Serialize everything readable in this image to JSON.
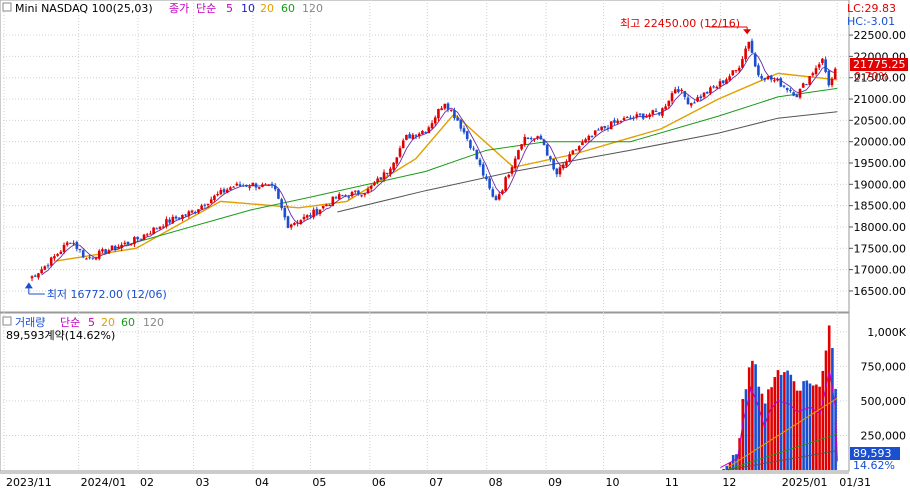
{
  "price_header": {
    "symbol": "Mini NASDAQ 100(25,03)",
    "close_label": "종가",
    "ma_label": "단순",
    "ma_periods": [
      "5",
      "10",
      "20",
      "60",
      "120"
    ],
    "ma_colors": [
      "#c000c0",
      "#1a1acc",
      "#e0a000",
      "#1a9a1a",
      "#888888"
    ]
  },
  "price_right": {
    "lc": "LC:29.83",
    "hc": "HC:-3.01",
    "last_price": "21775.25",
    "last_pct": "0.70%"
  },
  "volume_header": {
    "label": "거래량",
    "ma_label": "단순",
    "ma_periods": [
      "5",
      "20",
      "60",
      "120"
    ],
    "value_line": "89,593계약(14.62%)"
  },
  "volume_right": {
    "last_volume": "89,593",
    "last_pct": "14.62%"
  },
  "colors": {
    "up": "#e00000",
    "down": "#1a4fd0",
    "grid": "#d0d0d0",
    "badge_red": "#e00000",
    "badge_blue": "#1a4fd0"
  },
  "chart_data": [
    {
      "type": "candlestick",
      "title": "Mini NASDAQ 100(25,03)",
      "x_labels": [
        "2023/11",
        "2024/01",
        "02",
        "03",
        "04",
        "05",
        "06",
        "07",
        "08",
        "09",
        "10",
        "11",
        "12",
        "2025/01",
        "01/31"
      ],
      "y_ticks": [
        16500,
        17000,
        17500,
        18000,
        18500,
        19000,
        19500,
        20000,
        20500,
        21000,
        21500,
        22000,
        22500
      ],
      "y_tick_labels": [
        "16500.00",
        "17000.00",
        "17500.00",
        "18000.00",
        "18500.00",
        "19000.00",
        "19500.00",
        "20000.00",
        "20500.00",
        "21000.00",
        "21500.00",
        "22000.00",
        "22500.00"
      ],
      "ylim": [
        16100,
        22900
      ],
      "annotations": [
        {
          "text": "최고 22450.00 (12/16)",
          "value": 22450,
          "date": "12/16"
        },
        {
          "text": "최저 16772.00 (12/06)",
          "value": 16772,
          "date": "12/06"
        }
      ],
      "close_path": [
        [
          "2023-12-06",
          16772
        ],
        [
          "2023-12-15",
          17100
        ],
        [
          "2023-12-28",
          17700
        ],
        [
          "2024-01-05",
          17250
        ],
        [
          "2024-01-16",
          17450
        ],
        [
          "2024-01-31",
          17700
        ],
        [
          "2024-02-15",
          18100
        ],
        [
          "2024-02-29",
          18350
        ],
        [
          "2024-03-08",
          18600
        ],
        [
          "2024-03-21",
          18950
        ],
        [
          "2024-04-01",
          19000
        ],
        [
          "2024-04-12",
          18900
        ],
        [
          "2024-04-19",
          18050
        ],
        [
          "2024-04-30",
          18250
        ],
        [
          "2024-05-15",
          18700
        ],
        [
          "2024-05-31",
          18850
        ],
        [
          "2024-06-10",
          19300
        ],
        [
          "2024-06-20",
          20100
        ],
        [
          "2024-07-01",
          20300
        ],
        [
          "2024-07-10",
          20950
        ],
        [
          "2024-07-17",
          20500
        ],
        [
          "2024-07-25",
          19800
        ],
        [
          "2024-08-05",
          18600
        ],
        [
          "2024-08-09",
          18900
        ],
        [
          "2024-08-20",
          20100
        ],
        [
          "2024-08-30",
          20050
        ],
        [
          "2024-09-06",
          19200
        ],
        [
          "2024-09-17",
          19850
        ],
        [
          "2024-09-30",
          20300
        ],
        [
          "2024-10-10",
          20500
        ],
        [
          "2024-10-31",
          20700
        ],
        [
          "2024-11-08",
          21300
        ],
        [
          "2024-11-15",
          20900
        ],
        [
          "2024-11-29",
          21300
        ],
        [
          "2024-12-10",
          21700
        ],
        [
          "2024-12-16",
          22400
        ],
        [
          "2024-12-20",
          21600
        ],
        [
          "2024-12-31",
          21400
        ],
        [
          "2025-01-10",
          21100
        ],
        [
          "2025-01-23",
          21950
        ],
        [
          "2025-01-27",
          21300
        ],
        [
          "2025-01-31",
          21775.25
        ]
      ],
      "moving_averages": [
        {
          "name": "20",
          "points": [
            [
              "2023-12-20",
              17200
            ],
            [
              "2024-01-31",
              17500
            ],
            [
              "2024-03-15",
              18600
            ],
            [
              "2024-04-25",
              18450
            ],
            [
              "2024-05-20",
              18600
            ],
            [
              "2024-06-25",
              19600
            ],
            [
              "2024-07-15",
              20650
            ],
            [
              "2024-08-15",
              19400
            ],
            [
              "2024-09-15",
              19700
            ],
            [
              "2024-10-31",
              20300
            ],
            [
              "2024-11-30",
              21000
            ],
            [
              "2024-12-31",
              21600
            ],
            [
              "2025-01-31",
              21450
            ]
          ]
        },
        {
          "name": "60",
          "points": [
            [
              "2024-01-20",
              17500
            ],
            [
              "2024-03-31",
              18400
            ],
            [
              "2024-05-01",
              18700
            ],
            [
              "2024-06-30",
              19300
            ],
            [
              "2024-08-01",
              19800
            ],
            [
              "2024-09-01",
              20000
            ],
            [
              "2024-10-15",
              20000
            ],
            [
              "2024-11-30",
              20600
            ],
            [
              "2024-12-31",
              21050
            ],
            [
              "2025-01-31",
              21250
            ]
          ]
        },
        {
          "name": "120",
          "points": [
            [
              "2024-05-15",
              18350
            ],
            [
              "2024-06-30",
              18850
            ],
            [
              "2024-08-15",
              19300
            ],
            [
              "2024-10-15",
              19800
            ],
            [
              "2024-11-30",
              20200
            ],
            [
              "2024-12-31",
              20550
            ],
            [
              "2025-01-31",
              20700
            ]
          ]
        }
      ]
    },
    {
      "type": "bar",
      "title": "거래량",
      "y_ticks": [
        250000,
        500000,
        750000,
        1000000
      ],
      "y_tick_labels": [
        "250,000",
        "500,000",
        "750,000",
        "1,000K"
      ],
      "ylim": [
        0,
        1100000
      ],
      "volume_path": [
        [
          "2024-12-01",
          25000
        ],
        [
          "2024-12-10",
          120000
        ],
        [
          "2024-12-13",
          520000
        ],
        [
          "2024-12-16",
          750000
        ],
        [
          "2024-12-17",
          850000
        ],
        [
          "2024-12-20",
          700000
        ],
        [
          "2024-12-24",
          450000
        ],
        [
          "2024-12-27",
          620000
        ],
        [
          "2024-12-31",
          720000
        ],
        [
          "2025-01-06",
          680000
        ],
        [
          "2025-01-10",
          600000
        ],
        [
          "2025-01-17",
          650000
        ],
        [
          "2025-01-22",
          580000
        ],
        [
          "2025-01-27",
          1030000
        ],
        [
          "2025-01-30",
          650000
        ],
        [
          "2025-01-31",
          89593
        ]
      ]
    }
  ]
}
